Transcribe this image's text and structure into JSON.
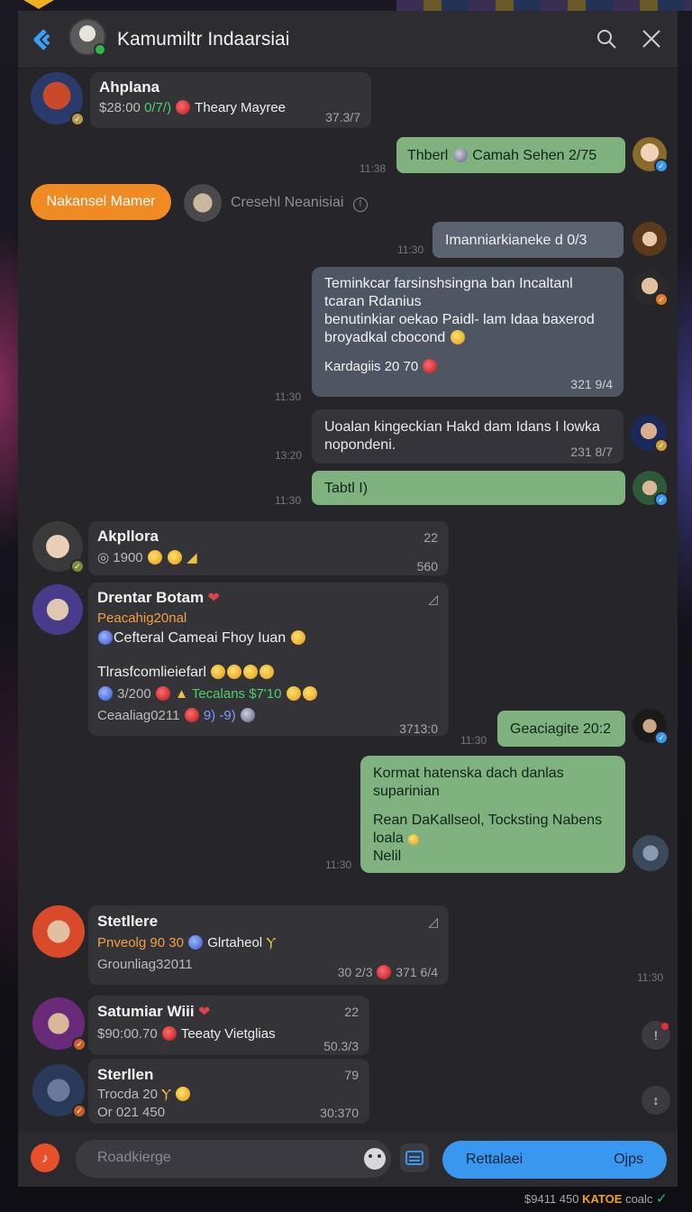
{
  "header": {
    "title": "Kamumiltr Indaarsiai"
  },
  "messages": {
    "m1": {
      "name": "Ahplana",
      "price": "$28:00",
      "count": "0/7/)",
      "text": "Theary Mayree",
      "meta": "37.3/7"
    },
    "m2": {
      "text": "Thberl",
      "name2": "Camah Sehen 2/75",
      "time": "11:38"
    },
    "m3": {
      "pill": "Nakansel Mamer",
      "text": "Cresehl Neanisiai"
    },
    "m4": {
      "text": "Imanniarkianeke d 0/3",
      "time": "11:30"
    },
    "m5": {
      "line1": "Teminkcar farsinshsingna ban Incaltanl",
      "line2": "tcaran Rdanius",
      "line3": "benutinkiar oekao Paidl- lam Idaa baxerod",
      "line4": "broyadkal cbocond",
      "line5": "Kardagiis 20 70",
      "meta": "321 9/4",
      "time": "11:30"
    },
    "m6": {
      "line1": "Uoalan kingeckian Hakd dam Idans I lowka",
      "line2": "nopondeni.",
      "meta": "231 8/7",
      "time": "13:20"
    },
    "m7": {
      "text": "Tabtl I)",
      "time": "11:30"
    },
    "m8": {
      "name": "Akpllora",
      "line": "1900",
      "meta1": "22",
      "meta2": "560"
    },
    "m9": {
      "name": "Drentar Botam",
      "line1": "Peacahig20nal",
      "line2": "Cefteral Cameai Fhoy Iuan",
      "line3": "Tlrasfcomlieiefarl",
      "line4a": "3/200",
      "line4b": "Tecalans $7'10",
      "line5": "Ceaaliag0211",
      "line5b": "9) -9)",
      "meta": "3713:0"
    },
    "m10": {
      "text": "Geaciagite 20:2",
      "time": "11:30"
    },
    "m11": {
      "line1": "Kormat hatenska dach danlas",
      "line2": "suparinian",
      "line3": "Rean DaKallseol, Tocksting Nabens",
      "line4": "loala",
      "line5": "Nelil",
      "time": "11:30"
    },
    "m12": {
      "name": "Stetllere",
      "line1a": "Pnveolg 90 30",
      "line1b": "Glrtaheol",
      "line2": "Grounliag32011",
      "meta1": "30 2/3",
      "meta2": "371 6/4",
      "time": "11:30"
    },
    "m13": {
      "name": "Satumiar Wiii",
      "line": "$90:00.70",
      "line_b": "Teeaty Vietglias",
      "meta1": "22",
      "meta2": "50.3/3"
    },
    "m14": {
      "name": "Sterllen",
      "line1": "Trocda 20",
      "line2": "Or 021 450",
      "meta1": "79",
      "meta2": "30:370"
    }
  },
  "composer": {
    "placeholder": "Roadkierge",
    "send_label": "Rettalaei",
    "send_options": "Ojps"
  },
  "footer": {
    "text": "$9411 450",
    "accent": "KATOE",
    "tail": "coalc"
  },
  "colors": {
    "accent_blue": "#3a97f0",
    "accent_orange": "#f08a22",
    "bubble_green": "#7fb27e",
    "online_green": "#2fb84a"
  }
}
